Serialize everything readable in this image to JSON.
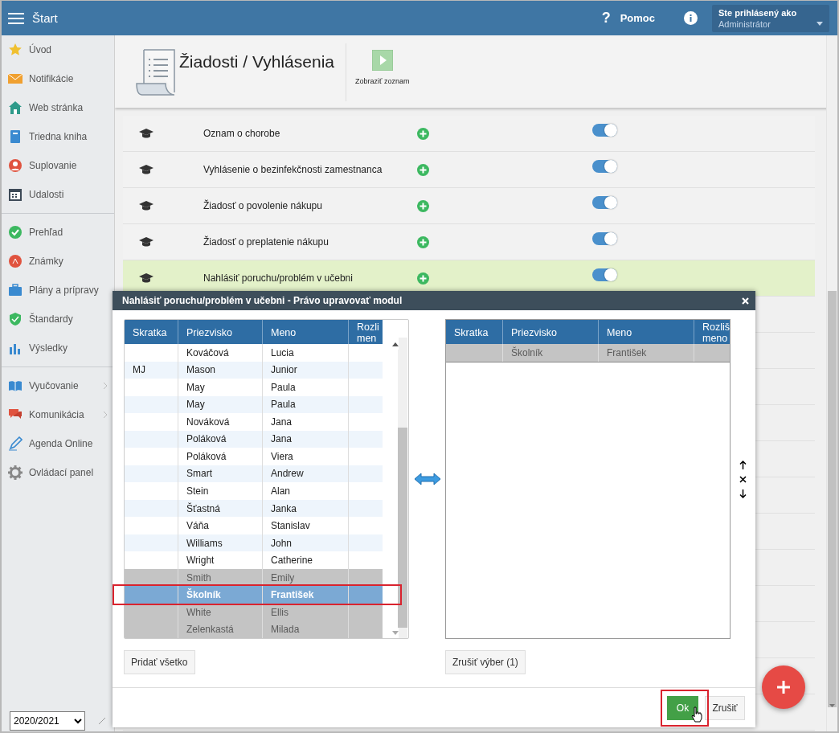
{
  "topbar": {
    "menu_label": "Štart",
    "help_icon": "?",
    "help_label": "Pomoc",
    "user_caption": "Ste prihlásený ako",
    "user_name": "Administrátor"
  },
  "sidebar": {
    "groups": [
      [
        {
          "label": "Úvod",
          "has_submenu": false
        },
        {
          "label": "Notifikácie",
          "has_submenu": false
        },
        {
          "label": "Web stránka",
          "has_submenu": false
        },
        {
          "label": "Triedna kniha",
          "has_submenu": false
        },
        {
          "label": "Suplovanie",
          "has_submenu": false
        },
        {
          "label": "Udalosti",
          "has_submenu": false
        }
      ],
      [
        {
          "label": "Prehľad",
          "has_submenu": false
        },
        {
          "label": "Známky",
          "has_submenu": false
        },
        {
          "label": "Plány a prípravy",
          "has_submenu": false
        },
        {
          "label": "Štandardy",
          "has_submenu": false
        },
        {
          "label": "Výsledky",
          "has_submenu": false
        }
      ],
      [
        {
          "label": "Vyučovanie",
          "has_submenu": true
        },
        {
          "label": "Komunikácia",
          "has_submenu": true
        },
        {
          "label": "Agenda Online",
          "has_submenu": false
        },
        {
          "label": "Ovládací panel",
          "has_submenu": false
        }
      ]
    ],
    "school_year": "2020/2021"
  },
  "page": {
    "title": "Žiadosti / Vyhlásenia",
    "toolbar": [
      {
        "label": "Zobraziť zoznam"
      }
    ]
  },
  "forms": [
    {
      "name": "Oznam o chorobe",
      "enabled": true,
      "selected": false
    },
    {
      "name": "Vyhlásenie o bezinfekčnosti zamestnanca",
      "enabled": true,
      "selected": false
    },
    {
      "name": "Žiadosť o povolenie nákupu",
      "enabled": true,
      "selected": false
    },
    {
      "name": "Žiadosť o preplatenie nákupu",
      "enabled": true,
      "selected": false
    },
    {
      "name": "Nahlásiť poruchu/problém v učebni",
      "enabled": true,
      "selected": true
    }
  ],
  "dialog": {
    "title": "Nahlásiť poruchu/problém v učebni - Právo upravovať modul",
    "available": {
      "columns": [
        "Skratka",
        "Priezvisko",
        "Meno",
        "Rozli men"
      ],
      "rows": [
        {
          "abbr": "",
          "surname": "Kováčová",
          "name": "Lucia",
          "assigned": false,
          "selected": false
        },
        {
          "abbr": "MJ",
          "surname": "Mason",
          "name": "Junior",
          "assigned": false,
          "selected": false
        },
        {
          "abbr": "",
          "surname": "May",
          "name": "Paula",
          "assigned": false,
          "selected": false
        },
        {
          "abbr": "",
          "surname": "May",
          "name": "Paula",
          "assigned": false,
          "selected": false
        },
        {
          "abbr": "",
          "surname": "Nováková",
          "name": "Jana",
          "assigned": false,
          "selected": false
        },
        {
          "abbr": "",
          "surname": "Poláková",
          "name": "Jana",
          "assigned": false,
          "selected": false
        },
        {
          "abbr": "",
          "surname": "Poláková",
          "name": "Viera",
          "assigned": false,
          "selected": false
        },
        {
          "abbr": "",
          "surname": "Smart",
          "name": "Andrew",
          "assigned": false,
          "selected": false
        },
        {
          "abbr": "",
          "surname": "Stein",
          "name": "Alan",
          "assigned": false,
          "selected": false
        },
        {
          "abbr": "",
          "surname": "Šťastná",
          "name": "Janka",
          "assigned": false,
          "selected": false
        },
        {
          "abbr": "",
          "surname": "Váňa",
          "name": "Stanislav",
          "assigned": false,
          "selected": false
        },
        {
          "abbr": "",
          "surname": "Williams",
          "name": "John",
          "assigned": false,
          "selected": false
        },
        {
          "abbr": "",
          "surname": "Wright",
          "name": "Catherine",
          "assigned": false,
          "selected": false
        },
        {
          "abbr": "",
          "surname": "Smith",
          "name": "Emily",
          "assigned": true,
          "selected": false
        },
        {
          "abbr": "",
          "surname": "Školník",
          "name": "František",
          "assigned": true,
          "selected": true
        },
        {
          "abbr": "",
          "surname": "White",
          "name": "Ellis",
          "assigned": true,
          "selected": false
        },
        {
          "abbr": "",
          "surname": "Zelenkastá",
          "name": "Milada",
          "assigned": true,
          "selected": false
        }
      ],
      "button": "Pridať všetko"
    },
    "chosen": {
      "columns": [
        "Skratka",
        "Priezvisko",
        "Meno",
        "Rozliš meno"
      ],
      "rows": [
        {
          "abbr": "",
          "surname": "Školník",
          "name": "František",
          "assigned": true,
          "selected": false
        }
      ],
      "button": "Zrušiť výber (1)"
    },
    "ok": "Ok",
    "cancel": "Zrušiť"
  }
}
